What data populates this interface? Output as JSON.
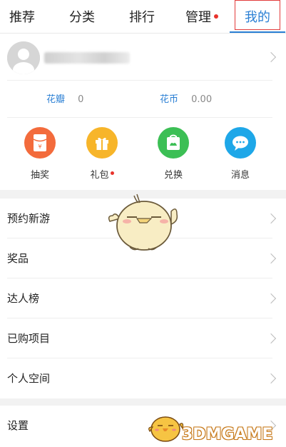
{
  "tabs": [
    {
      "label": "推荐",
      "dot": false
    },
    {
      "label": "分类",
      "dot": false
    },
    {
      "label": "排行",
      "dot": false
    },
    {
      "label": "管理",
      "dot": true
    },
    {
      "label": "我的",
      "dot": false,
      "active": true
    }
  ],
  "profile": {
    "avatar": "avatar-placeholder-icon",
    "username": "(blurred)"
  },
  "balances": [
    {
      "label": "花瓣",
      "value": "0"
    },
    {
      "label": "花币",
      "value": "0.00"
    }
  ],
  "actions": [
    {
      "label": "抽奖",
      "icon": "red-envelope-icon",
      "color": "#f36b3c",
      "dot": false
    },
    {
      "label": "礼包",
      "icon": "gift-icon",
      "color": "#f7b52a",
      "dot": true
    },
    {
      "label": "兑换",
      "icon": "exchange-bag-icon",
      "color": "#3cbf55",
      "dot": false
    },
    {
      "label": "消息",
      "icon": "message-bubble-icon",
      "color": "#1ea7e8",
      "dot": false
    }
  ],
  "menu_group_1": [
    {
      "label": "预约新游"
    },
    {
      "label": "奖品"
    },
    {
      "label": "达人榜"
    },
    {
      "label": "已购项目"
    },
    {
      "label": "个人空间"
    }
  ],
  "menu_group_2": [
    {
      "label": "设置"
    }
  ],
  "watermark": "3DMGAME",
  "colors": {
    "accent": "#2a7fd4",
    "badge": "#e8332c",
    "active_frame": "#e23b3b"
  }
}
